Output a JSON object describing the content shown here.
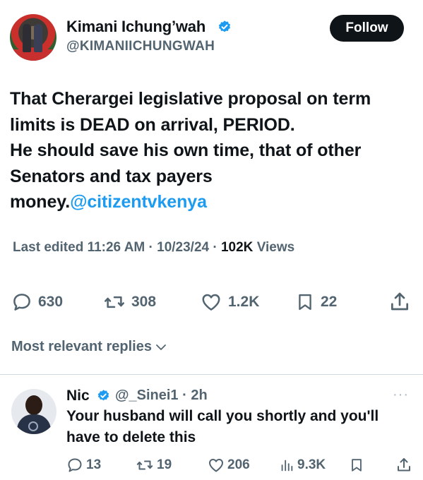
{
  "author": {
    "display_name": "Kimani Ichung’wah",
    "handle": "@KIMANIICHUNGWAH",
    "follow_label": "Follow"
  },
  "tweet": {
    "lines": [
      "That Cherargei legislative proposal on term",
      "limits is DEAD on arrival, PERIOD.",
      "He should save his own time, that of other",
      "Senators and tax payers"
    ],
    "last_line_text": "money.",
    "mention": "@citizentvkenya"
  },
  "meta": {
    "edited": "Last edited 11:26 AM · 10/23/24",
    "separator": " · ",
    "views_count": "102K",
    "views_label": "Views"
  },
  "actions": {
    "replies": "630",
    "reposts": "308",
    "likes": "1.2K",
    "bookmarks": "22"
  },
  "replies_filter": {
    "label": "Most relevant replies"
  },
  "reply": {
    "name": "Nic",
    "handle_time": "@_Sinei1 · 2h",
    "more": "···",
    "text_lines": [
      "Your husband will call you shortly and you'll",
      "have to delete this"
    ],
    "actions": {
      "replies": "13",
      "reposts": "19",
      "likes": "206",
      "views": "9.3K"
    }
  },
  "colors": {
    "text": "#0f1419",
    "secondary": "#536471",
    "accent": "#1d9bf0",
    "button_bg": "#0f1419"
  }
}
